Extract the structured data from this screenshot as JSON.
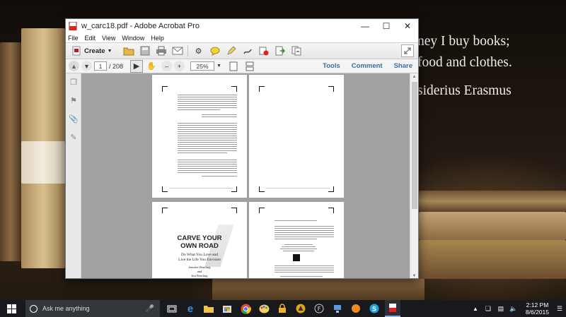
{
  "desktop": {
    "quote_lines": [
      "ney I buy books;",
      "food and clothes.",
      "siderius Erasmus"
    ]
  },
  "window": {
    "title": "w_carc18.pdf - Adobe Acrobat Pro",
    "menu": [
      "File",
      "Edit",
      "View",
      "Window",
      "Help"
    ],
    "create_label": "Create",
    "page_current": "1",
    "page_total": "/ 208",
    "zoom": "25%",
    "nav": {
      "tools": "Tools",
      "comment": "Comment",
      "share": "Share"
    }
  },
  "document": {
    "page3": {
      "title_lines": [
        "CARVE YOUR",
        "OWN ROAD"
      ],
      "subtitle_lines": [
        "Do What You Love and",
        "Live the Life You Envision"
      ],
      "author_lines": [
        "Jennifer Remling",
        "and",
        "Jim Remling"
      ]
    }
  },
  "taskbar": {
    "search_placeholder": "Ask me anything",
    "time": "2:12 PM",
    "date": "8/6/2015"
  },
  "colors": {
    "accent": "#3d6e9b",
    "taskbar": "#17191c"
  }
}
